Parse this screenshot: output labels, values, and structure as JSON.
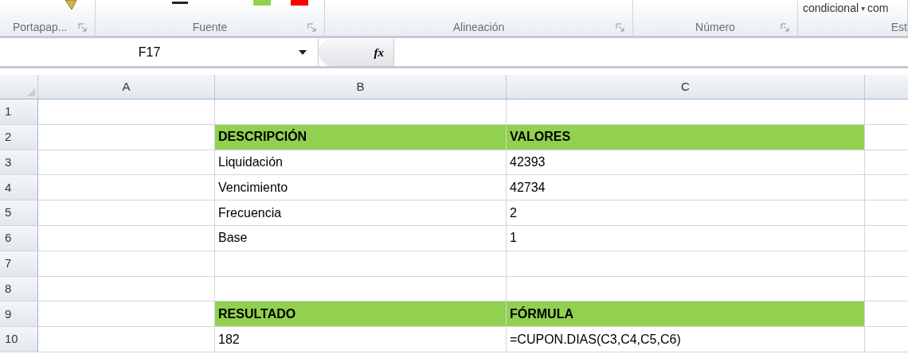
{
  "ribbon": {
    "top_texts": [
      "condicional",
      "▾",
      "com"
    ],
    "groups": [
      {
        "label": "Portapap...",
        "launcher": true
      },
      {
        "label": "Fuente",
        "launcher": true
      },
      {
        "label": "Alineación",
        "launcher": true
      },
      {
        "label": "Número",
        "launcher": true
      },
      {
        "label": "Est",
        "launcher": false
      }
    ]
  },
  "formula_bar": {
    "name_box": "F17",
    "fx": "fx"
  },
  "sheet": {
    "columns": [
      "A",
      "B",
      "C"
    ],
    "rows": [
      {
        "number": "1",
        "kind": "data",
        "cells": [
          "",
          ""
        ]
      },
      {
        "number": "2",
        "kind": "header",
        "cells": [
          "DESCRIPCIÓN",
          "VALORES"
        ]
      },
      {
        "number": "3",
        "kind": "data",
        "cells": [
          "Liquidación",
          "42393"
        ]
      },
      {
        "number": "4",
        "kind": "data",
        "cells": [
          "Vencimiento",
          "42734"
        ]
      },
      {
        "number": "5",
        "kind": "data",
        "cells": [
          "Frecuencia",
          "2"
        ]
      },
      {
        "number": "6",
        "kind": "data",
        "cells": [
          "Base",
          "1"
        ]
      },
      {
        "number": "7",
        "kind": "data",
        "cells": [
          "",
          ""
        ]
      },
      {
        "number": "8",
        "kind": "data",
        "cells": [
          "",
          ""
        ]
      },
      {
        "number": "9",
        "kind": "header",
        "cells": [
          "RESULTADO",
          "FÓRMULA"
        ]
      },
      {
        "number": "10",
        "kind": "data",
        "cells": [
          "182",
          "=CUPON.DIAS(C3,C4,C5,C6)"
        ]
      }
    ]
  }
}
